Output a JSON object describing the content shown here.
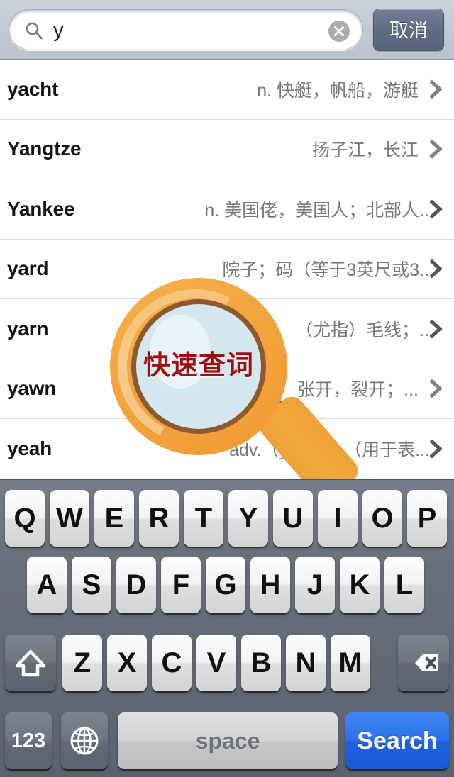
{
  "search": {
    "value": "y",
    "placeholder": "",
    "icon": "search-icon",
    "clear_icon": "clear-circle-icon",
    "cancel_label": "取消"
  },
  "results": [
    {
      "word": "yacht",
      "definition": "n. 快艇，帆船，游艇",
      "chevron": "chevron-right-icon"
    },
    {
      "word": "Yangtze",
      "definition": "扬子江，长江",
      "chevron": "chevron-right-icon"
    },
    {
      "word": "Yankee",
      "definition": "n. 美国佬，美国人；北部人...",
      "chevron": "chevron-right-icon"
    },
    {
      "word": "yard",
      "definition": "院子；码（等于3英尺或3...",
      "chevron": "chevron-right-icon"
    },
    {
      "word": "yarn",
      "definition": "（尤指）毛线；...",
      "chevron": "chevron-right-icon"
    },
    {
      "word": "yawn",
      "definition": "张开，裂开；...",
      "chevron": "chevron-right-icon"
    },
    {
      "word": "yeah",
      "definition": "adv.（yes的...    （用于表...",
      "chevron": "chevron-right-icon"
    }
  ],
  "overlay": {
    "label": "快速查词",
    "icon": "magnifier-icon",
    "ring_color": "#f2a63f",
    "lens_color": "#d4e7ef",
    "label_color": "#9c1010",
    "handle_color": "#eda13a"
  },
  "keyboard": {
    "row1": [
      "Q",
      "W",
      "E",
      "R",
      "T",
      "Y",
      "U",
      "I",
      "O",
      "P"
    ],
    "row2": [
      "A",
      "S",
      "D",
      "F",
      "G",
      "H",
      "J",
      "K",
      "L"
    ],
    "row3": [
      "Z",
      "X",
      "C",
      "V",
      "B",
      "N",
      "M"
    ],
    "shift_icon": "shift-icon",
    "backspace_icon": "backspace-icon",
    "numeric_label": "123",
    "globe_icon": "globe-icon",
    "space_label": "space",
    "search_label": "Search",
    "accent_color": "#2d72ec"
  }
}
